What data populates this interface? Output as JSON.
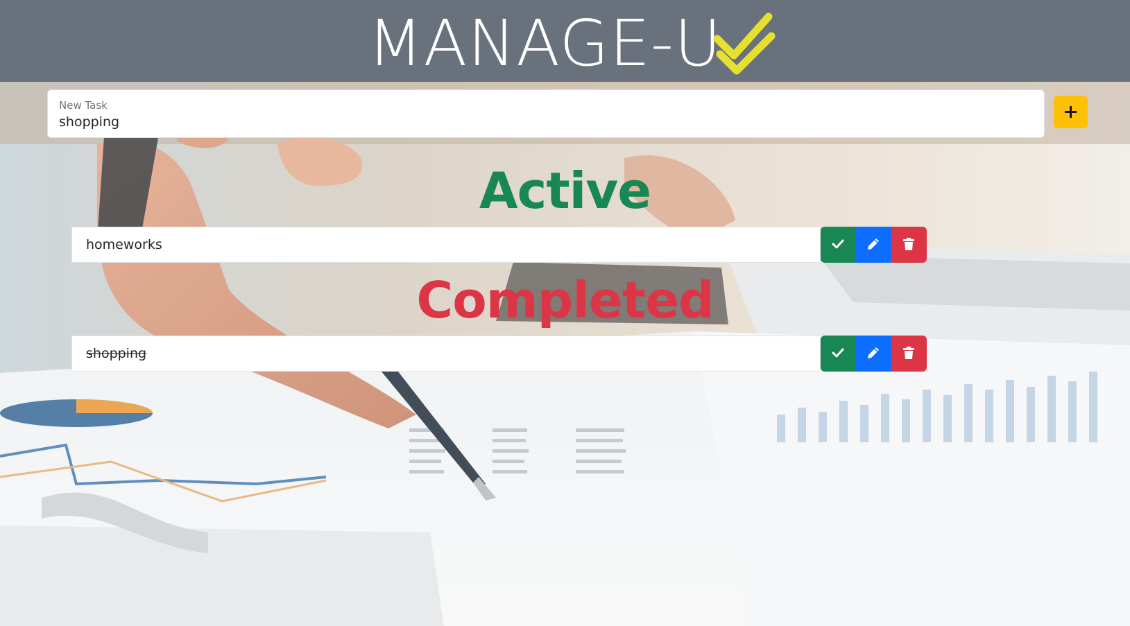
{
  "header": {
    "logo_text": "MANAGE-U",
    "logo_check_icon": "double-check-icon",
    "logo_check_color": "#e6e02e",
    "background_color": "#69717c"
  },
  "new_task": {
    "label": "New Task",
    "value": "shopping",
    "add_icon": "plus-icon",
    "add_button_color": "#ffc107"
  },
  "sections": {
    "active": {
      "title": "Active",
      "color": "#198754",
      "tasks": [
        {
          "text": "homeworks"
        }
      ]
    },
    "completed": {
      "title": "Completed",
      "color": "#dc3545",
      "tasks": [
        {
          "text": "shopping"
        }
      ]
    }
  },
  "task_actions": {
    "done_icon": "check-icon",
    "edit_icon": "pencil-icon",
    "delete_icon": "trash-icon",
    "done_color": "#198754",
    "edit_color": "#0d6efd",
    "delete_color": "#dc3545"
  },
  "background_image": "office-desk-with-financial-charts-and-pen"
}
